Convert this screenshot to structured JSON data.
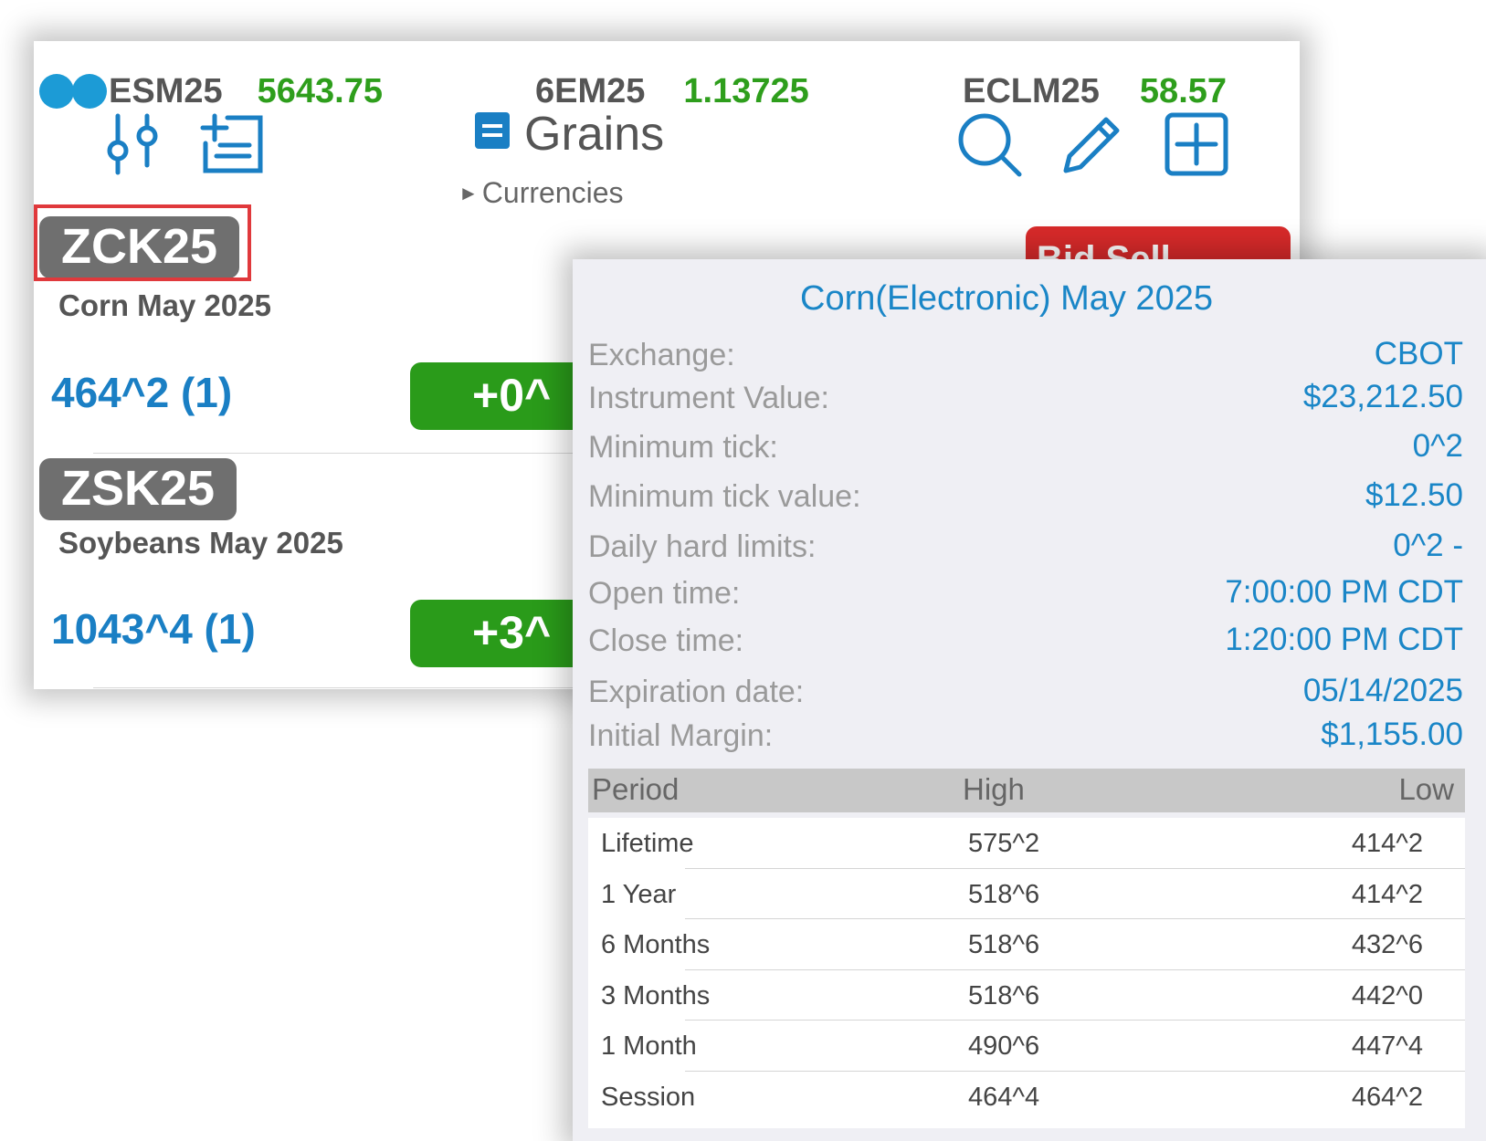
{
  "header": {
    "tickers": [
      {
        "symbol": "ESM25",
        "price": "5643.75"
      },
      {
        "symbol": "6EM25",
        "price": "1.13725"
      },
      {
        "symbol": "ECLM25",
        "price": "58.57"
      }
    ],
    "section_title": "Grains",
    "subsection": "Currencies"
  },
  "contracts": [
    {
      "symbol": "ZCK25",
      "description": "Corn  May 2025",
      "price": "464^2 (1)",
      "change": "+0^"
    },
    {
      "symbol": "ZSK25",
      "description": "Soybeans  May 2025",
      "price": "1043^4 (1)",
      "change": "+3^"
    }
  ],
  "order_button": {
    "label": "Bid Sell"
  },
  "popup": {
    "title": "Corn(Electronic) May 2025",
    "properties": [
      {
        "label": "Exchange:",
        "value": "CBOT"
      },
      {
        "label": "Instrument Value:",
        "value": "$23,212.50"
      },
      {
        "label": "Minimum tick:",
        "value": "0^2"
      },
      {
        "label": "Minimum tick value:",
        "value": "$12.50"
      },
      {
        "label": "Daily hard limits:",
        "value": "0^2 -"
      },
      {
        "label": "Open time:",
        "value": "7:00:00 PM CDT"
      },
      {
        "label": "Close time:",
        "value": "1:20:00 PM CDT"
      },
      {
        "label": "Expiration date:",
        "value": "05/14/2025"
      },
      {
        "label": "Initial Margin:",
        "value": "$1,155.00"
      }
    ],
    "range_table": {
      "headers": [
        "Period",
        "High",
        "Low"
      ],
      "rows": [
        {
          "period": "Lifetime",
          "high": "575^2",
          "low": "414^2"
        },
        {
          "period": "1 Year",
          "high": "518^6",
          "low": "414^2"
        },
        {
          "period": "6 Months",
          "high": "518^6",
          "low": "432^6"
        },
        {
          "period": "3 Months",
          "high": "518^6",
          "low": "442^0"
        },
        {
          "period": "1 Month",
          "high": "490^6",
          "low": "447^4"
        },
        {
          "period": "Session",
          "high": "464^4",
          "low": "464^2"
        }
      ]
    }
  },
  "colors": {
    "accent_blue": "#1a86c7",
    "positive_green": "#2a9b1a",
    "sell_red": "#d82a2a",
    "highlight_red": "#e0393c",
    "badge_gray": "#6f6f6f"
  },
  "icons": [
    "connection-status-icon",
    "settings-sliders-icon",
    "add-list-icon",
    "list-menu-icon",
    "search-icon",
    "edit-pencil-icon",
    "add-square-icon"
  ]
}
